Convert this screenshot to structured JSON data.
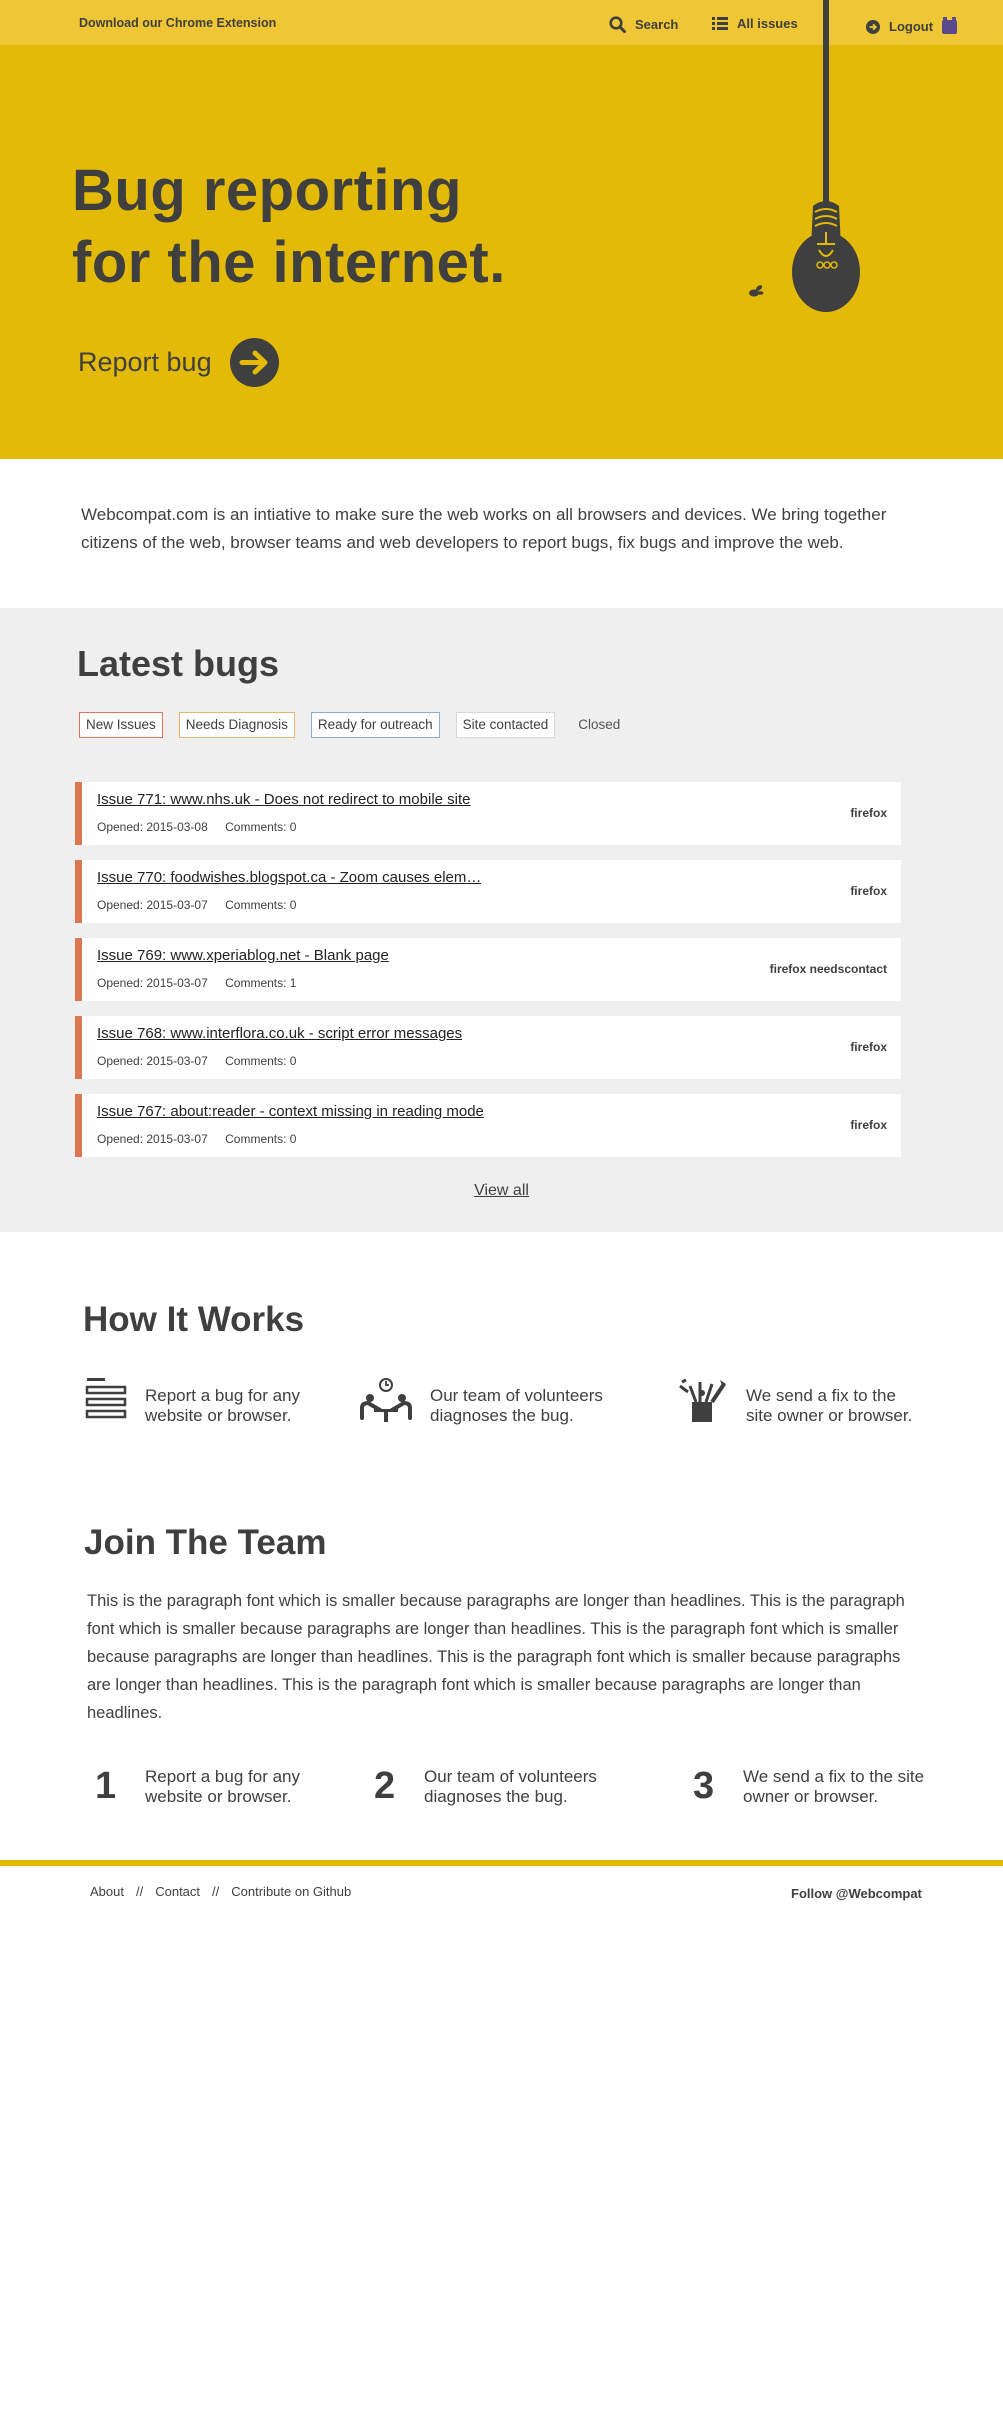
{
  "header": {
    "extension_link": "Download our Chrome Extension",
    "search": "Search",
    "all_issues": "All issues",
    "logout": "Logout"
  },
  "hero": {
    "title_line1": "Bug reporting",
    "title_line2": "for the internet.",
    "report_bug": "Report bug"
  },
  "intro": "Webcompat.com is an intiative to make sure the web works on all browsers and devices. We bring together citizens of the web, browser teams and web developers to report bugs, fix bugs and improve the web.",
  "latest_bugs": {
    "title": "Latest bugs",
    "filters": [
      "New Issues",
      "Needs Diagnosis",
      "Ready for outreach",
      "Site contacted",
      "Closed"
    ],
    "issues": [
      {
        "title": "Issue 771: www.nhs.uk - Does not redirect to mobile site",
        "opened": "Opened: 2015-03-08",
        "comments": "Comments: 0",
        "labels": "firefox"
      },
      {
        "title": "Issue 770: foodwishes.blogspot.ca - Zoom causes elem…",
        "opened": "Opened: 2015-03-07",
        "comments": "Comments: 0",
        "labels": "firefox"
      },
      {
        "title": "Issue 769: www.xperiablog.net - Blank page",
        "opened": "Opened: 2015-03-07",
        "comments": "Comments: 1",
        "labels": "firefox needscontact"
      },
      {
        "title": "Issue 768: www.interflora.co.uk - script error messages",
        "opened": "Opened: 2015-03-07",
        "comments": "Comments: 0",
        "labels": "firefox"
      },
      {
        "title": "Issue 767: about:reader - context missing in reading mode",
        "opened": "Opened: 2015-03-07",
        "comments": "Comments: 0",
        "labels": "firefox"
      }
    ],
    "view_all": "View all"
  },
  "how_it_works": {
    "title": "How It Works",
    "steps": [
      {
        "icon": "list-icon",
        "text": "Report a bug for any website or browser."
      },
      {
        "icon": "team-icon",
        "text": "Our team of volunteers diagnoses the bug."
      },
      {
        "icon": "tools-icon",
        "text": "We send a fix to the site owner or browser."
      }
    ]
  },
  "join": {
    "title": "Join The Team",
    "paragraph": "This is the paragraph font which is smaller because paragraphs are longer than headlines.  This is the paragraph font which is smaller because paragraphs are longer than headlines.  This is the paragraph font which is smaller because paragraphs are longer than headlines.  This is the paragraph font which is smaller because paragraphs are longer than headlines.  This is the paragraph font which is smaller because paragraphs are longer than headlines.",
    "steps": [
      {
        "num": "1",
        "text": "Report a bug for any website or browser."
      },
      {
        "num": "2",
        "text": "Our team of volunteers diagnoses the bug."
      },
      {
        "num": "3",
        "text": "We send a fix to the site owner or browser."
      }
    ]
  },
  "footer": {
    "about": "About",
    "sep": "//",
    "contact": "Contact",
    "github": "Contribute on Github",
    "follow": "Follow @Webcompat"
  },
  "colors": {
    "hero_yellow": "#e3ba07",
    "topbar_yellow": "#eec636",
    "issue_accent": "#db7853",
    "text_dark": "#3f3f3f"
  }
}
